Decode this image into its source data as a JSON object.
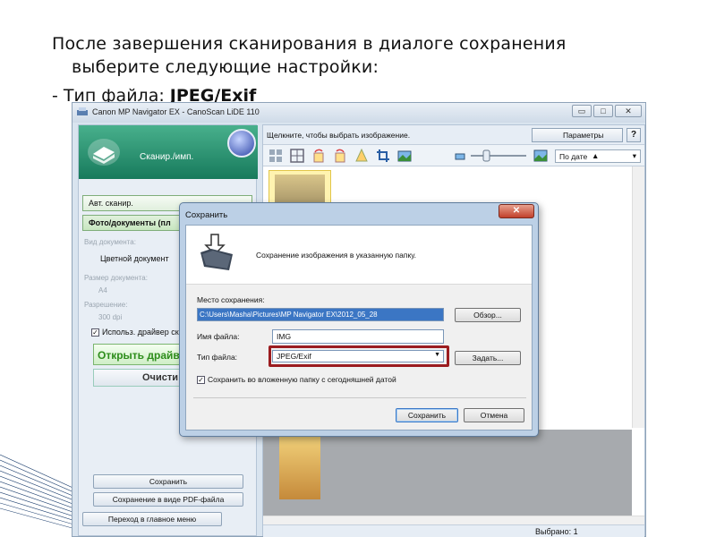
{
  "slide": {
    "line1": "После завершения сканирования в диалоге сохранения",
    "line2": "выберите следующие настройки:",
    "line3_prefix": "- Тип файла: ",
    "line3_value": "JPEG/Exif"
  },
  "app": {
    "title": "Canon MP Navigator EX - CanoScan LiDE 110",
    "window_buttons": {
      "minimize": "▭",
      "maximize": "□",
      "close": "✕"
    }
  },
  "left_panel": {
    "header_label": "Сканир./имп.",
    "auto_scan": "Авт. сканир.",
    "photo_docs": "Фото/документы (пл",
    "doc_type_label": "Вид документа:",
    "doc_type_value": "Цветной документ",
    "doc_size_label": "Размер документа:",
    "doc_size_value": "A4",
    "resolution_label": "Разрешение:",
    "resolution_value": "300 dpi",
    "use_driver_checkbox": "Использ. драйвер ск",
    "open_driver_button": "Открыть драйве",
    "clear_button": "Очисти",
    "save_button": "Сохранить",
    "save_pdf_button": "Сохранение в виде PDF-файла",
    "main_menu_button": "Переход в главное меню"
  },
  "workspace": {
    "hint": "Щелкните, чтобы выбрать изображение.",
    "params_button": "Параметры",
    "help_button": "?",
    "sort_value": "По дате",
    "selected_count": "Выбрано: 1"
  },
  "dialog": {
    "title": "Сохранить",
    "banner_text": "Сохранение изображения в указанную папку.",
    "location_label": "Место сохранения:",
    "location_value": "C:\\Users\\Masha\\Pictures\\MP Navigator EX\\2012_05_28",
    "browse_button": "Обзор...",
    "filename_label": "Имя файла:",
    "filename_value": "IMG",
    "filetype_label": "Тип файла:",
    "filetype_value": "JPEG/Exif",
    "set_button": "Задать...",
    "subfolder_checkbox": "Сохранить во вложенную папку с сегодняшней датой",
    "save_button": "Сохранить",
    "cancel_button": "Отмена"
  },
  "colors": {
    "highlight_border": "#9b1c20",
    "scan_header": "#177a5c",
    "path_selection": "#3b76c4"
  }
}
